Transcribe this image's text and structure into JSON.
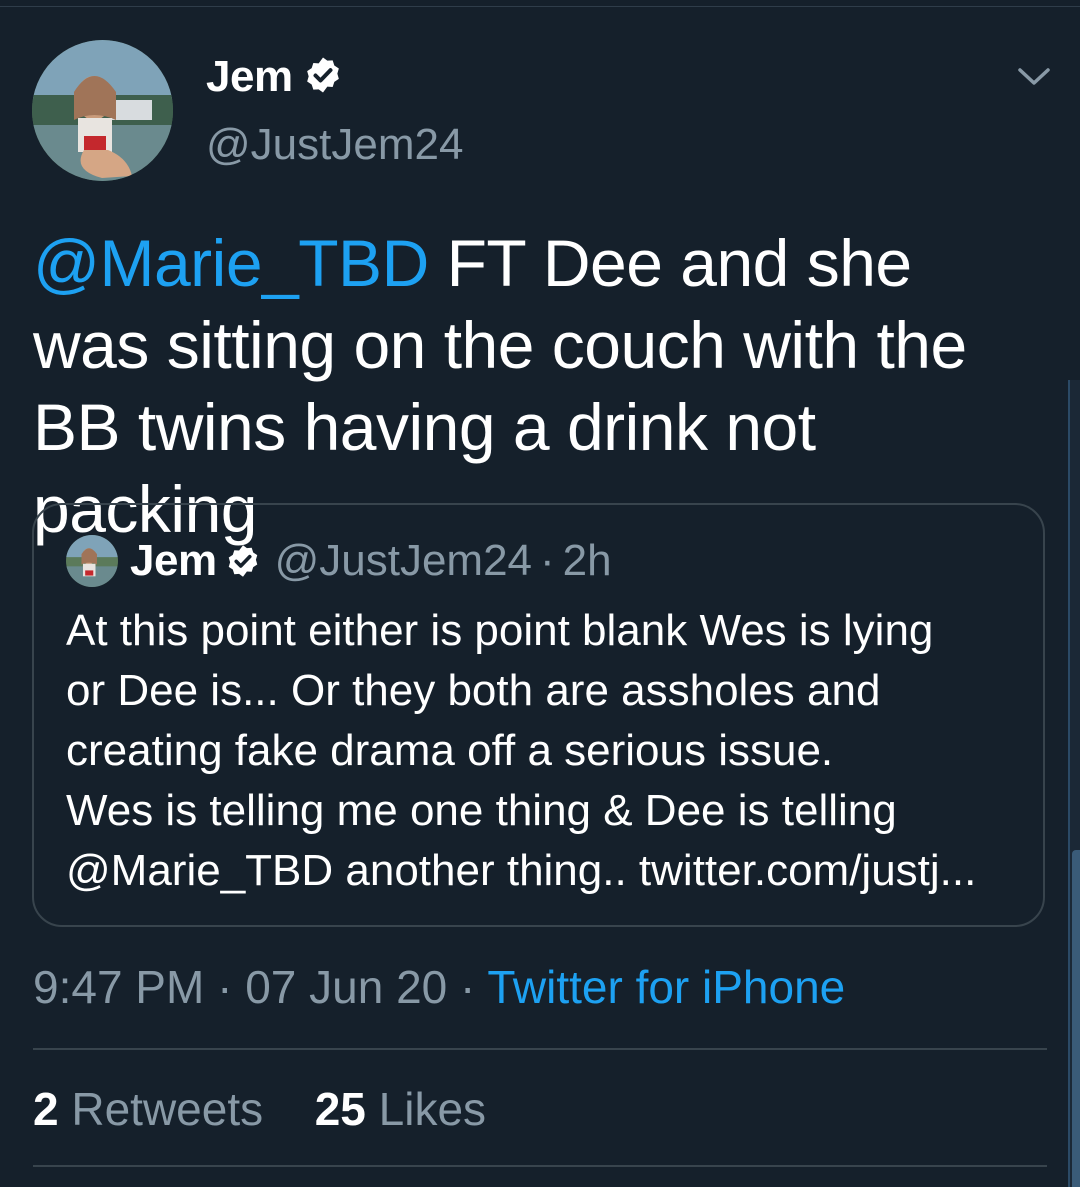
{
  "tweet": {
    "author_name": "Jem",
    "author_handle": "@JustJem24",
    "mention": "@Marie_TBD",
    "text": " FT Dee and she was sitting on the couch with the BB twins having a drink not packing",
    "time": "9:47 PM",
    "date": "07 Jun 20",
    "source": "Twitter for iPhone",
    "retweets_count": "2",
    "retweets_label": "Retweets",
    "likes_count": "25",
    "likes_label": "Likes"
  },
  "quoted": {
    "author_name": "Jem",
    "author_handle": "@JustJem24",
    "separator": "·",
    "age": "2h",
    "lines": [
      "At this point either is point blank Wes is lying",
      "or Dee is... Or they both are assholes and",
      "creating fake drama off a serious issue.",
      "Wes is telling me one thing & Dee is telling",
      "@Marie_TBD another thing.. twitter.com/justj..."
    ]
  },
  "meta_separator": "·",
  "icons": {
    "verified": "verified-badge-icon",
    "menu": "chevron-down-icon"
  },
  "colors": {
    "background": "#15202b",
    "accent": "#1da1f2",
    "secondary_text": "#8899a6",
    "border": "#38444d"
  }
}
